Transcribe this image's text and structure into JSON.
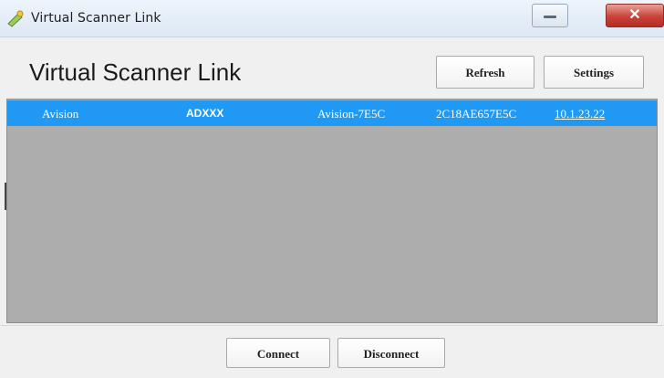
{
  "window": {
    "title": "Virtual Scanner Link"
  },
  "header": {
    "title": "Virtual Scanner Link",
    "refresh_label": "Refresh",
    "settings_label": "Settings"
  },
  "scanner_list": {
    "selected_row": {
      "vendor": "Avision",
      "model": "ADXXX",
      "name": "Avision-7E5C",
      "mac": "2C18AE657E5C",
      "ip": "10.1.23.22"
    }
  },
  "footer": {
    "connect_label": "Connect",
    "disconnect_label": "Disconnect"
  },
  "colors": {
    "selection": "#1f99f4",
    "list_background": "#adadad",
    "close_button": "#c8433a"
  },
  "icons": {
    "app": "scanner-app-icon",
    "minimize": "minimize-icon",
    "close": "close-icon"
  }
}
